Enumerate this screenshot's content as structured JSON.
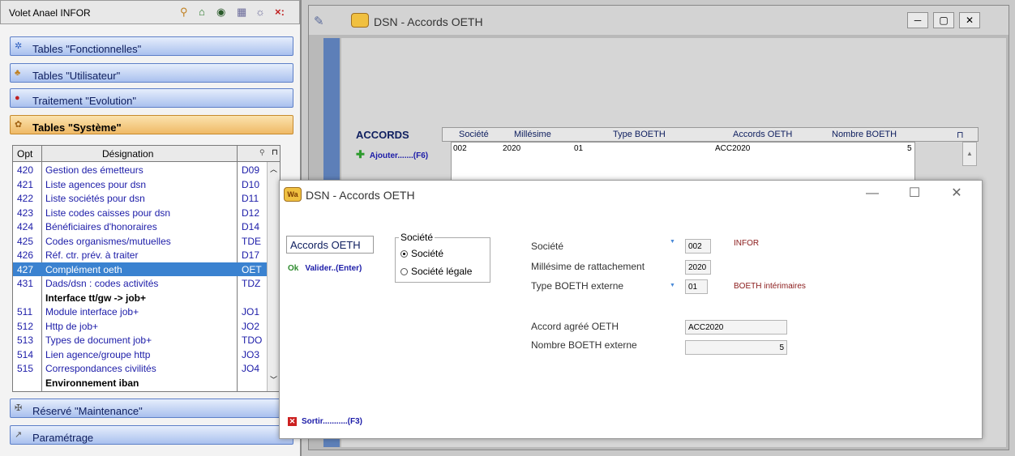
{
  "left_panel": {
    "title": "Volet Anael INFOR",
    "toolbar_close": "×:",
    "groups": [
      {
        "label": "Tables \"Fonctionnelles\"",
        "icon": "gear-icon"
      },
      {
        "label": "Tables \"Utilisateur\"",
        "icon": "users-icon"
      },
      {
        "label": "Traitement \"Evolution\"",
        "icon": "chart-icon"
      },
      {
        "label": "Tables \"Système\"",
        "icon": "system-icon"
      },
      {
        "label": "Réservé \"Maintenance\"",
        "icon": "tools-icon"
      },
      {
        "label": "Paramétrage",
        "icon": "wrench-icon"
      }
    ],
    "table": {
      "headers": {
        "opt": "Opt",
        "designation": "Désignation"
      },
      "rows": [
        {
          "opt": "420",
          "designation": "Gestion des émetteurs",
          "code": "D09"
        },
        {
          "opt": "421",
          "designation": "Liste agences pour dsn",
          "code": "D10"
        },
        {
          "opt": "422",
          "designation": "Liste sociétés pour dsn",
          "code": "D11"
        },
        {
          "opt": "423",
          "designation": "Liste codes caisses pour dsn",
          "code": "D12"
        },
        {
          "opt": "424",
          "designation": "Bénéficiaires d'honoraires",
          "code": "D14"
        },
        {
          "opt": "425",
          "designation": "Codes organismes/mutuelles",
          "code": "TDE"
        },
        {
          "opt": "426",
          "designation": "Réf. ctr. prév. à traiter",
          "code": "D17"
        },
        {
          "opt": "427",
          "designation": "Complément oeth",
          "code": "OET"
        },
        {
          "opt": "431",
          "designation": "Dads/dsn : codes activités",
          "code": "TDZ"
        },
        {
          "opt": "",
          "designation": "Interface tt/gw -> job+",
          "code": ""
        },
        {
          "opt": "511",
          "designation": "Module interface job+",
          "code": "JO1"
        },
        {
          "opt": "512",
          "designation": "Http de job+",
          "code": "JO2"
        },
        {
          "opt": "513",
          "designation": "Types de document job+",
          "code": "TDO"
        },
        {
          "opt": "514",
          "designation": "Lien agence/groupe http",
          "code": "JO3"
        },
        {
          "opt": "515",
          "designation": "Correspondances civilités",
          "code": "JO4"
        },
        {
          "opt": "",
          "designation": "Environnement iban",
          "code": ""
        }
      ]
    }
  },
  "back_window": {
    "title": "DSN - Accords OETH",
    "section_label": "ACCORDS",
    "add_action": "Ajouter.......(F6)",
    "columns": [
      "Société",
      "Millésime",
      "Type BOETH",
      "Accords OETH",
      "Nombre BOETH"
    ],
    "row": {
      "societe": "002",
      "millesime": "2020",
      "type": "01",
      "accord": "ACC2020",
      "nombre": "5"
    }
  },
  "dialog": {
    "title": "DSN - Accords OETH",
    "app_icon_text": "Wa",
    "panel_title": "Accords OETH",
    "validate": "Valider..(Enter)",
    "validate_prefix": "Ok",
    "exit": "Sortir...........(F3)",
    "societe_group": {
      "title": "Société",
      "option1": "Société",
      "option2": "Société légale",
      "selected": "Société"
    },
    "fields": {
      "societe": {
        "label": "Société",
        "value": "002",
        "desc": "INFOR"
      },
      "millesime": {
        "label": "Millésime de rattachement",
        "value": "2020"
      },
      "type_boeth": {
        "label": "Type BOETH externe",
        "value": "01",
        "desc": "BOETH intérimaires"
      },
      "accord": {
        "label": "Accord agréé OETH",
        "value": "ACC2020"
      },
      "nombre": {
        "label": "Nombre BOETH externe",
        "value": "5"
      }
    }
  },
  "colors": {
    "selected_row": "#3a82d0",
    "active_group": "#efb966",
    "link_blue": "#1c1ca8"
  }
}
